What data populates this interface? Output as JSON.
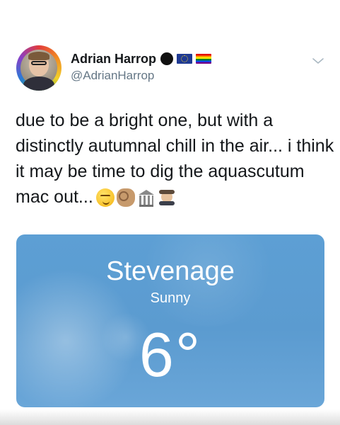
{
  "tweet": {
    "author": {
      "name": "Adrian Harrop",
      "handle": "@AdrianHarrop",
      "badges": [
        "black-circle-icon",
        "eu-flag-icon",
        "rainbow-flag-icon"
      ]
    },
    "text_lines": [
      "due to be a bright one, but with a",
      "distinctly autumnal chill in the air... i think",
      "it may be time to dig the aquascutum",
      "mac out..."
    ],
    "emojis": [
      "smirking-face-emoji",
      "ok-hand-emoji",
      "classical-building-emoji",
      "detective-emoji"
    ],
    "menu_icon": "chevron-down-icon"
  },
  "weather": {
    "city": "Stevenage",
    "condition": "Sunny",
    "temperature": "6°",
    "background_color": "#5b9bd0"
  },
  "colors": {
    "text_primary": "#14171a",
    "text_secondary": "#657786"
  }
}
